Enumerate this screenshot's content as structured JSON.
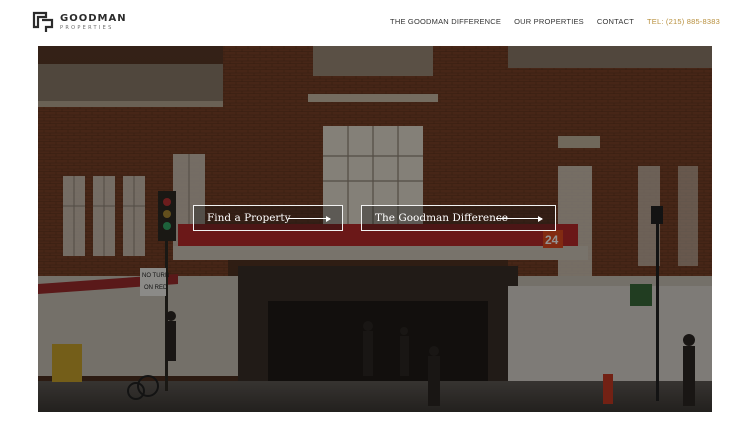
{
  "header": {
    "logo_name": "GOODMAN",
    "logo_sub": "PROPERTIES",
    "nav": [
      {
        "label": "THE GOODMAN DIFFERENCE"
      },
      {
        "label": "OUR PROPERTIES"
      },
      {
        "label": "CONTACT"
      }
    ],
    "phone": "TEL: (215) 885-8383"
  },
  "hero": {
    "cta_find": "Find a Property",
    "cta_difference": "The Goodman Difference",
    "sign_text": "NO TURN ON RED",
    "number_sign": "24"
  },
  "colors": {
    "phone": "#b8903e",
    "brick": "#6e3a22",
    "overlay": "#000000"
  }
}
